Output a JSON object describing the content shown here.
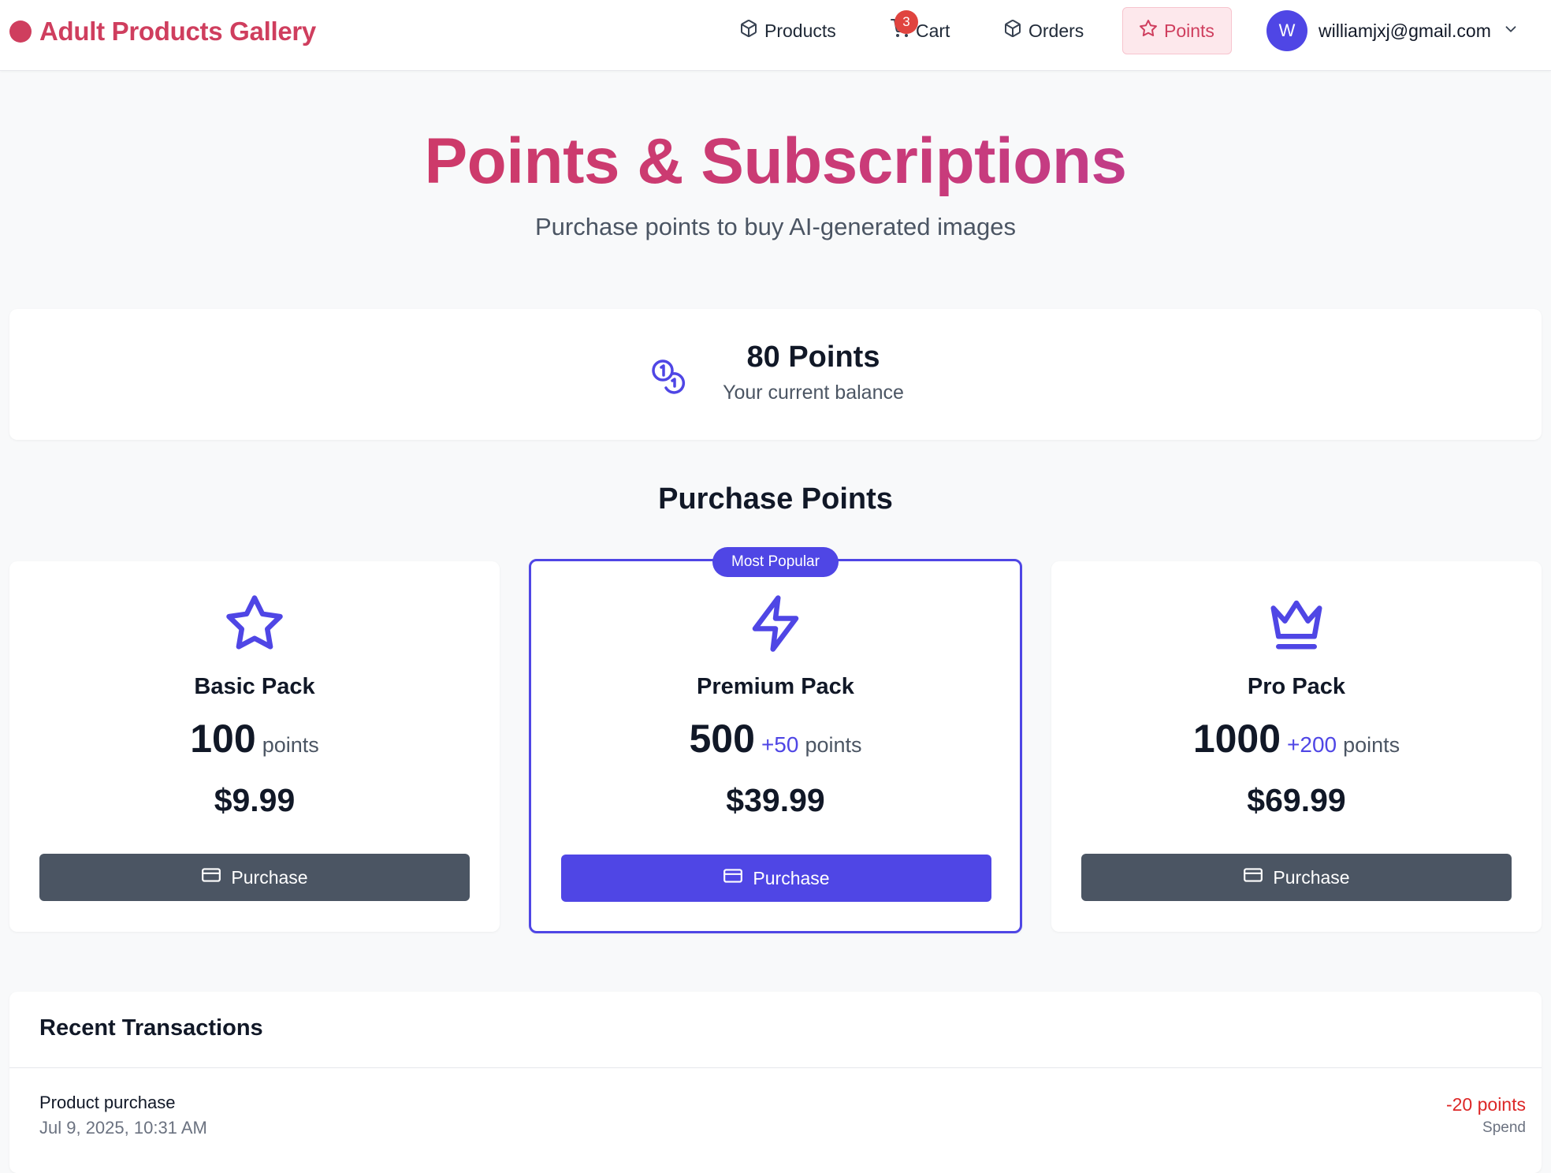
{
  "header": {
    "brand": "Adult Products Gallery",
    "nav": {
      "products": "Products",
      "cart": "Cart",
      "cart_count": "3",
      "orders": "Orders",
      "points": "Points"
    },
    "user": {
      "avatar_initial": "W",
      "email": "williamjxj@gmail.com"
    }
  },
  "hero": {
    "title": "Points & Subscriptions",
    "subtitle": "Purchase points to buy AI-generated images"
  },
  "balance": {
    "amount": "80 Points",
    "label": "Your current balance"
  },
  "packs_section": {
    "title": "Purchase Points",
    "popular_badge": "Most Popular",
    "packs": [
      {
        "name": "Basic Pack",
        "points": "100",
        "bonus": "",
        "unit": "points",
        "price": "$9.99",
        "button": "Purchase",
        "icon": "star-icon"
      },
      {
        "name": "Premium Pack",
        "points": "500",
        "bonus": "+50",
        "unit": "points",
        "price": "$39.99",
        "button": "Purchase",
        "icon": "lightning-icon"
      },
      {
        "name": "Pro Pack",
        "points": "1000",
        "bonus": "+200",
        "unit": "points",
        "price": "$69.99",
        "button": "Purchase",
        "icon": "crown-icon"
      }
    ]
  },
  "transactions": {
    "title": "Recent Transactions",
    "items": [
      {
        "description": "Product purchase",
        "date": "Jul 9, 2025, 10:31 AM",
        "amount": "-20 points",
        "type": "Spend"
      }
    ]
  },
  "colors": {
    "brand": "#cf3e5e",
    "accent": "#4f46e5",
    "button_dark": "#4b5563",
    "negative": "#dc2626"
  }
}
